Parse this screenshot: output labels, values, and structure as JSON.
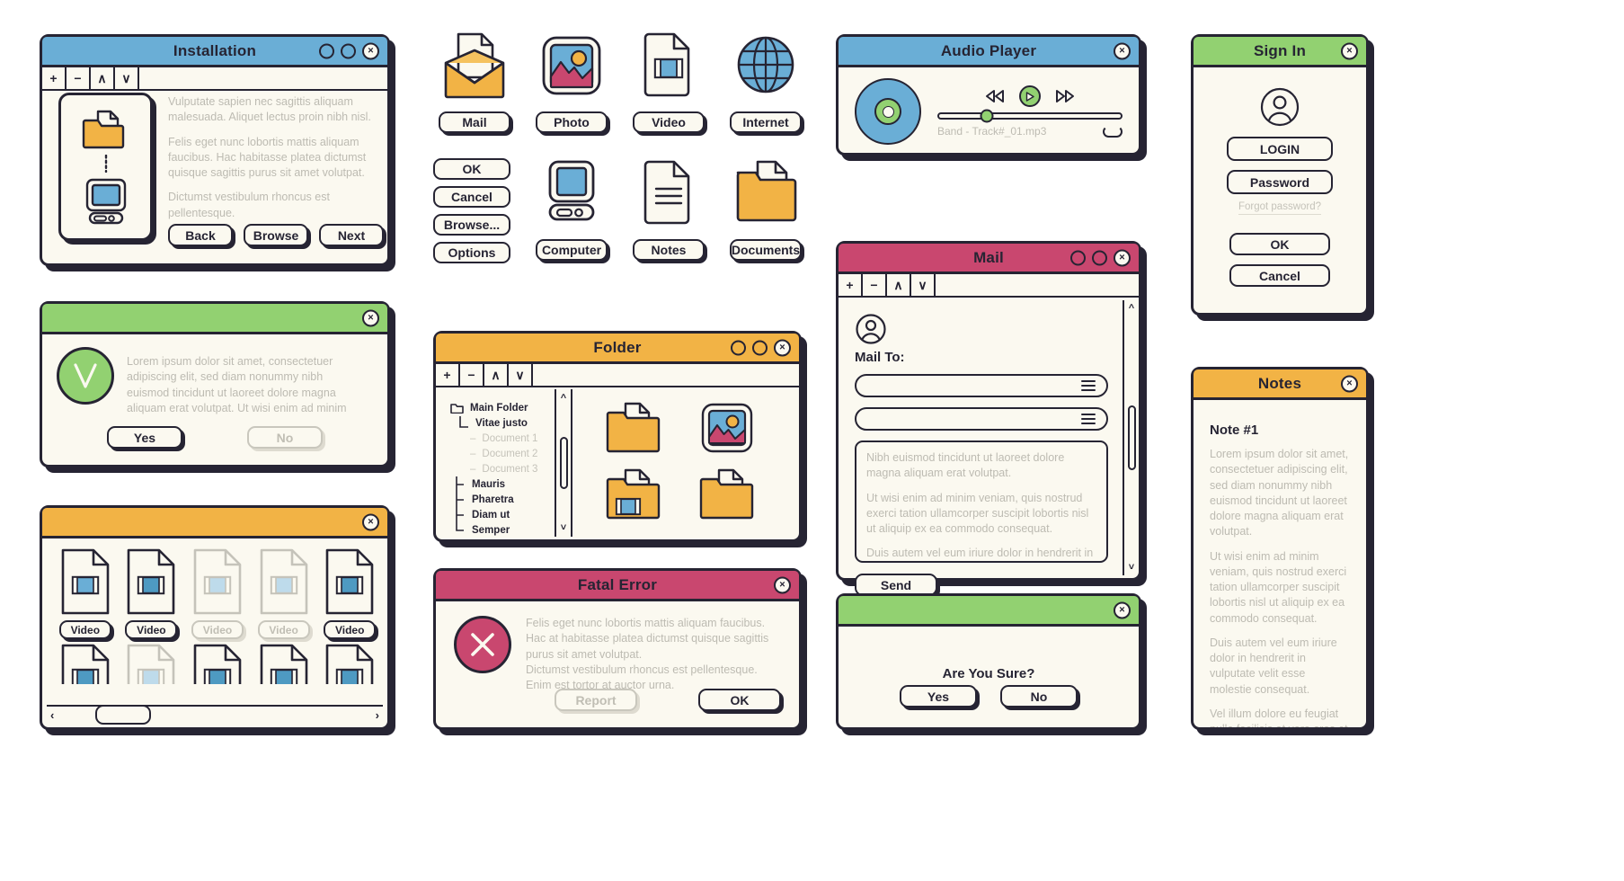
{
  "colors": {
    "ink": "#262433",
    "paper": "#fbf9f0",
    "blue": "#6aaed6",
    "green": "#92d171",
    "yellow": "#f2b345",
    "pink": "#c9476f",
    "muted_text": "#bdbbb2"
  },
  "installation": {
    "title": "Installation",
    "nav": [
      "+",
      "−",
      "∧",
      "∨"
    ],
    "paragraphs": [
      "Vulputate sapien nec sagittis aliquam malesuada. Aliquet lectus proin nibh nisl.",
      "Felis eget nunc lobortis mattis aliquam faucibus. Hac habitasse platea dictumst quisque sagittis purus sit amet volutpat.",
      "Dictumst vestibulum rhoncus est pellentesque."
    ],
    "buttons": [
      "Back",
      "Browse",
      "Next"
    ]
  },
  "confirm": {
    "title": "",
    "icon": "check-circle-icon",
    "message": "Lorem ipsum dolor sit amet, consectetuer adipiscing elit, sed diam nonummy nibh euismod tincidunt ut laoreet dolore magna aliquam erat volutpat. Ut wisi enim ad minim",
    "yes_label": "Yes",
    "no_label": "No"
  },
  "gallery": {
    "title": "",
    "items": [
      {
        "label": "Video",
        "state": "normal"
      },
      {
        "label": "Video",
        "state": "normal"
      },
      {
        "label": "Video",
        "state": "disabled"
      },
      {
        "label": "Video",
        "state": "disabled"
      },
      {
        "label": "Video",
        "state": "normal"
      }
    ],
    "row2_states": [
      "normal",
      "disabled",
      "normal",
      "normal",
      "normal"
    ],
    "scroll_left": "‹",
    "scroll_right": "›"
  },
  "icon_grid": {
    "tiles": [
      {
        "label": "Mail",
        "icon": "mail-icon"
      },
      {
        "label": "Photo",
        "icon": "photo-icon"
      },
      {
        "label": "Video",
        "icon": "video-file-icon"
      },
      {
        "label": "Internet",
        "icon": "globe-icon"
      },
      {
        "label": "Computer",
        "icon": "computer-icon"
      },
      {
        "label": "Notes",
        "icon": "notes-file-icon"
      },
      {
        "label": "Documents",
        "icon": "documents-folder-icon"
      }
    ],
    "buttons": [
      "OK",
      "Cancel",
      "Browse...",
      "Options"
    ]
  },
  "folder": {
    "title": "Folder",
    "nav": [
      "+",
      "−",
      "∧",
      "∨"
    ],
    "tree": [
      {
        "label": "Main Folder",
        "level": 0,
        "dim": false,
        "marker": "folder"
      },
      {
        "label": "Vitae justo",
        "level": 1,
        "dim": false,
        "marker": "elbow"
      },
      {
        "label": "Document 1",
        "level": 2,
        "dim": true,
        "marker": "dash"
      },
      {
        "label": "Document 2",
        "level": 2,
        "dim": true,
        "marker": "dash"
      },
      {
        "label": "Document 3",
        "level": 2,
        "dim": true,
        "marker": "dash"
      },
      {
        "label": "Mauris",
        "level": 1,
        "dim": false,
        "marker": "tee"
      },
      {
        "label": "Pharetra",
        "level": 1,
        "dim": false,
        "marker": "tee"
      },
      {
        "label": "Diam ut",
        "level": 1,
        "dim": false,
        "marker": "tee"
      },
      {
        "label": "Semper",
        "level": 1,
        "dim": false,
        "marker": "corner"
      }
    ],
    "files": [
      "folder-icon",
      "photo-icon",
      "video-folder-icon",
      "folder-icon"
    ]
  },
  "fatal_error": {
    "title": "Fatal Error",
    "icon": "error-x-icon",
    "message_lines": [
      "Felis eget nunc lobortis mattis aliquam faucibus. Hac at habitasse platea dictumst quisque sagittis purus sit amet volutpat.",
      "Dictumst vestibulum rhoncus est pellentesque. Enim est tortor at auctor urna."
    ],
    "report_label": "Report",
    "ok_label": "OK"
  },
  "audio_player": {
    "title": "Audio Player",
    "prev": "⏮",
    "play": "▶",
    "next": "⏭",
    "track": "Band - Track#_01.mp3",
    "progress_percent": 26,
    "loop": "loop-icon"
  },
  "mail": {
    "title": "Mail",
    "nav": [
      "+",
      "−",
      "∧",
      "∨"
    ],
    "mail_to_label": "Mail To:",
    "field_values": [
      "",
      ""
    ],
    "field_placeholder": "",
    "body_paragraphs": [
      "Nibh euismod tincidunt ut laoreet dolore magna aliquam erat volutpat.",
      "Ut wisi enim ad minim veniam, quis nostrud exerci tation ullamcorper suscipit lobortis nisl ut aliquip ex ea commodo consequat.",
      "Duis autem vel eum iriure dolor in hendrerit in"
    ],
    "send_label": "Send",
    "avatar": "user-avatar-icon"
  },
  "are_you_sure": {
    "title": "",
    "question": "Are You Sure?",
    "yes_label": "Yes",
    "no_label": "No"
  },
  "sign_in": {
    "title": "Sign In",
    "avatar": "user-avatar-icon",
    "login_label": "LOGIN",
    "password_label": "Password",
    "forgot_label": "Forgot password?",
    "ok_label": "OK",
    "cancel_label": "Cancel"
  },
  "notes": {
    "title": "Notes",
    "heading": "Note #1",
    "paragraphs": [
      "Lorem ipsum dolor sit amet, consectetuer adipiscing elit, sed diam nonummy nibh euismod tincidunt ut laoreet dolore magna aliquam erat volutpat.",
      "Ut wisi enim ad minim veniam, quis nostrud exerci tation ullamcorper suscipit lobortis nisl ut aliquip ex ea commodo consequat.",
      "Duis autem vel eum iriure dolor in hendrerit in vulputate velit esse molestie consequat.",
      "Vel illum dolore eu feugiat nulla facilisis at vero eros et accumsan et iusto odio dignissim qui blandit praesent luptatum zzril delenit augue duis dolore te feugait nulla facilisi."
    ]
  },
  "close_glyph": "×"
}
